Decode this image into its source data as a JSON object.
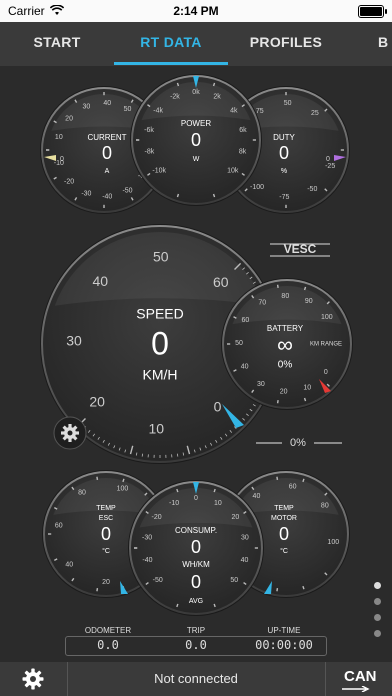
{
  "status_bar": {
    "carrier": "Carrier",
    "time": "2:14 PM"
  },
  "tabs": [
    "START",
    "RT DATA",
    "PROFILES",
    "B"
  ],
  "active_tab": "RT DATA",
  "accent_color": "#33b5e5",
  "gauges": {
    "current": {
      "title": "CURRENT",
      "value": "0",
      "unit": "A",
      "ticks": [
        "0",
        "10",
        "20",
        "30",
        "40",
        "50",
        "60",
        "-10",
        "-20",
        "-30",
        "-40",
        "-50",
        "-60",
        "0"
      ]
    },
    "power": {
      "title": "POWER",
      "value": "0",
      "unit": "W",
      "ticks": [
        "-10k",
        "-8k",
        "-6k",
        "-4k",
        "-2k",
        "0k",
        "2k",
        "4k",
        "6k",
        "8k",
        "10k"
      ]
    },
    "duty": {
      "title": "DUTY",
      "value": "0",
      "unit": "%",
      "ticks": [
        "100",
        "75",
        "50",
        "25",
        "0",
        "-25",
        "-50",
        "-75",
        "-100"
      ]
    },
    "speed": {
      "title": "SPEED",
      "value": "0",
      "unit": "KM/H",
      "ticks": [
        "0",
        "10",
        "20",
        "30",
        "40",
        "50",
        "60"
      ]
    },
    "battery": {
      "title": "BATTERY",
      "value": "∞",
      "range_label": "KM RANGE",
      "percent": "0%",
      "ticks": [
        "0",
        "10",
        "20",
        "30",
        "40",
        "50",
        "60",
        "70",
        "80",
        "90",
        "100"
      ]
    },
    "temp_esc": {
      "title": "TEMP\nESC",
      "title_lines": [
        "TEMP",
        "ESC"
      ],
      "value": "0",
      "unit": "°C",
      "ticks": [
        "0",
        "20",
        "40",
        "60",
        "80",
        "100"
      ]
    },
    "consumption": {
      "title": "CONSUMP.",
      "value": "0",
      "unit": "WH/KM",
      "avg_value": "0",
      "avg_label": "AVG",
      "ticks": [
        "-50",
        "-40",
        "-30",
        "-20",
        "-10",
        "0",
        "10",
        "20",
        "30",
        "40",
        "50"
      ]
    },
    "temp_motor": {
      "title_lines": [
        "TEMP",
        "MOTOR"
      ],
      "value": "0",
      "unit": "°C",
      "ticks": [
        "0",
        "20",
        "40",
        "60",
        "80",
        "100"
      ]
    }
  },
  "logo": "VESC",
  "speed_progress": "0%",
  "trip": {
    "odometer_label": "ODOMETER",
    "odometer_value": "0.0",
    "trip_label": "TRIP",
    "trip_value": "0.0",
    "uptime_label": "UP-TIME",
    "uptime_value": "00:00:00"
  },
  "bottom": {
    "connection_status": "Not connected",
    "can_label": "CAN"
  },
  "icons": [
    "wifi-icon",
    "battery-icon",
    "settings-gear-icon",
    "can-bus-icon"
  ]
}
